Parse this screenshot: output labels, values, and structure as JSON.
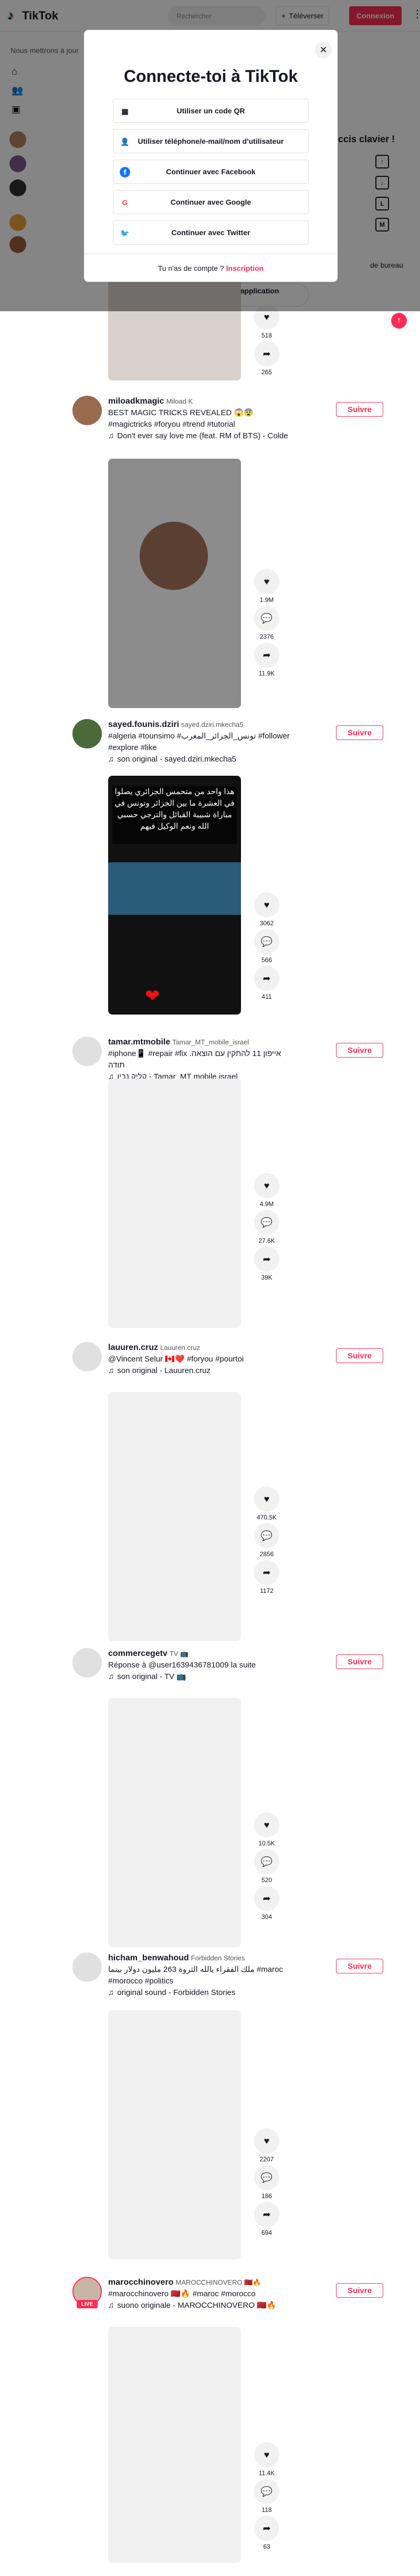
{
  "header": {
    "logo_text": "TikTok",
    "search_placeholder": "Rechercher",
    "upload_label": "Téléverser",
    "login_label": "Connexion"
  },
  "side": {
    "notice": "Nous mettrons à jour"
  },
  "modal": {
    "title": "Connecte-toi à TikTok",
    "options": [
      {
        "label": "Utiliser un code QR",
        "icon": "qr-icon"
      },
      {
        "label": "Utiliser téléphone/e-mail/nom d'utilisateur",
        "icon": "user-icon"
      },
      {
        "label": "Continuer avec Facebook",
        "icon": "facebook-icon",
        "color": "#1877f2"
      },
      {
        "label": "Continuer avec Google",
        "icon": "google-icon"
      },
      {
        "label": "Continuer avec Twitter",
        "icon": "twitter-icon",
        "color": "#1da1f2"
      }
    ],
    "footer_text": "Tu n'as de compte ?",
    "footer_link": "Inscription"
  },
  "background_panels": {
    "keyboard_title": "ccis clavier !",
    "desktop_text": "de bureau",
    "download_label": "Télécharge l'application TikTok"
  },
  "posts": [
    {
      "username": "miloadkmagic",
      "nickname": "Miload K",
      "desc": "BEST MAGIC TRICKS REVEALED 😱😨#magictricks #foryou #trend #tutorial",
      "music": "Don't ever say love me (feat. RM of BTS) - Colde",
      "follow_label": "Suivre",
      "likes": "1.9M",
      "comments": "2376",
      "shares": "11.9K"
    },
    {
      "username": "sayed.founis.dziri",
      "nickname": "sayed.dziri.mkecha5",
      "desc": "#algeria #tounsimo #تونس_الجزائر_المغرب #follower #explore #like",
      "music": "son original - sayed.dziri.mkecha5",
      "follow_label": "Suivre",
      "video_text": "هذا واحد من متحمس الجزائري يصلوا في العشرة ما بين الجزائر وتونس في مباراة شبيبة القبائل والترجي حسبي الله ونعم الوكيل فيهم",
      "likes": "3062",
      "comments": "566",
      "shares": "411"
    },
    {
      "username": "tamar.mtmobile",
      "nickname": "Tamar_MT_mobile_israel",
      "desc": "#iphone📱 #repair #fix אייפון 11 להתקין עם הוצאה. תודה",
      "music": "קליק נבין - Tamar_MT mobile israel",
      "follow_label": "Suivre",
      "likes": "4.9M",
      "comments": "27.6K",
      "shares": "39K"
    },
    {
      "username": "lauuren.cruz",
      "nickname": "Lauuren.cruz",
      "desc": "@Vincent Selur 🇨🇦❤️ #foryou #pourtoi",
      "music": "son original - Lauuren.cruz",
      "follow_label": "Suivre",
      "likes": "470.5K",
      "comments": "2856",
      "shares": "1172"
    },
    {
      "username": "commercegetv",
      "nickname": "TV 📺",
      "desc": "Réponse à @user1639436781009 la suite",
      "music": "son original - TV 📺",
      "follow_label": "Suivre",
      "likes": "10.5K",
      "comments": "520",
      "shares": "304"
    },
    {
      "username": "hicham_benwahoud",
      "nickname": "Forbidden Stories",
      "desc": "ملك الفقراء يالله الثروة 263 مليون دولار بينما #maroc #morocco #politics",
      "music": "original sound - Forbidden Stories",
      "follow_label": "Suivre",
      "likes": "2207",
      "comments": "186",
      "shares": "694"
    },
    {
      "username": "marocchinovero",
      "nickname": "MAROCCHINOVERO 🇲🇦🔥",
      "desc": "#marocchinovero 🇲🇦🔥 #maroc #morocco",
      "music": "suono originale - MAROCCHINOVERO 🇲🇦🔥",
      "follow_label": "Suivre",
      "live_label": "LIVE",
      "likes": "11.4K",
      "comments": "118",
      "shares": "63"
    }
  ]
}
